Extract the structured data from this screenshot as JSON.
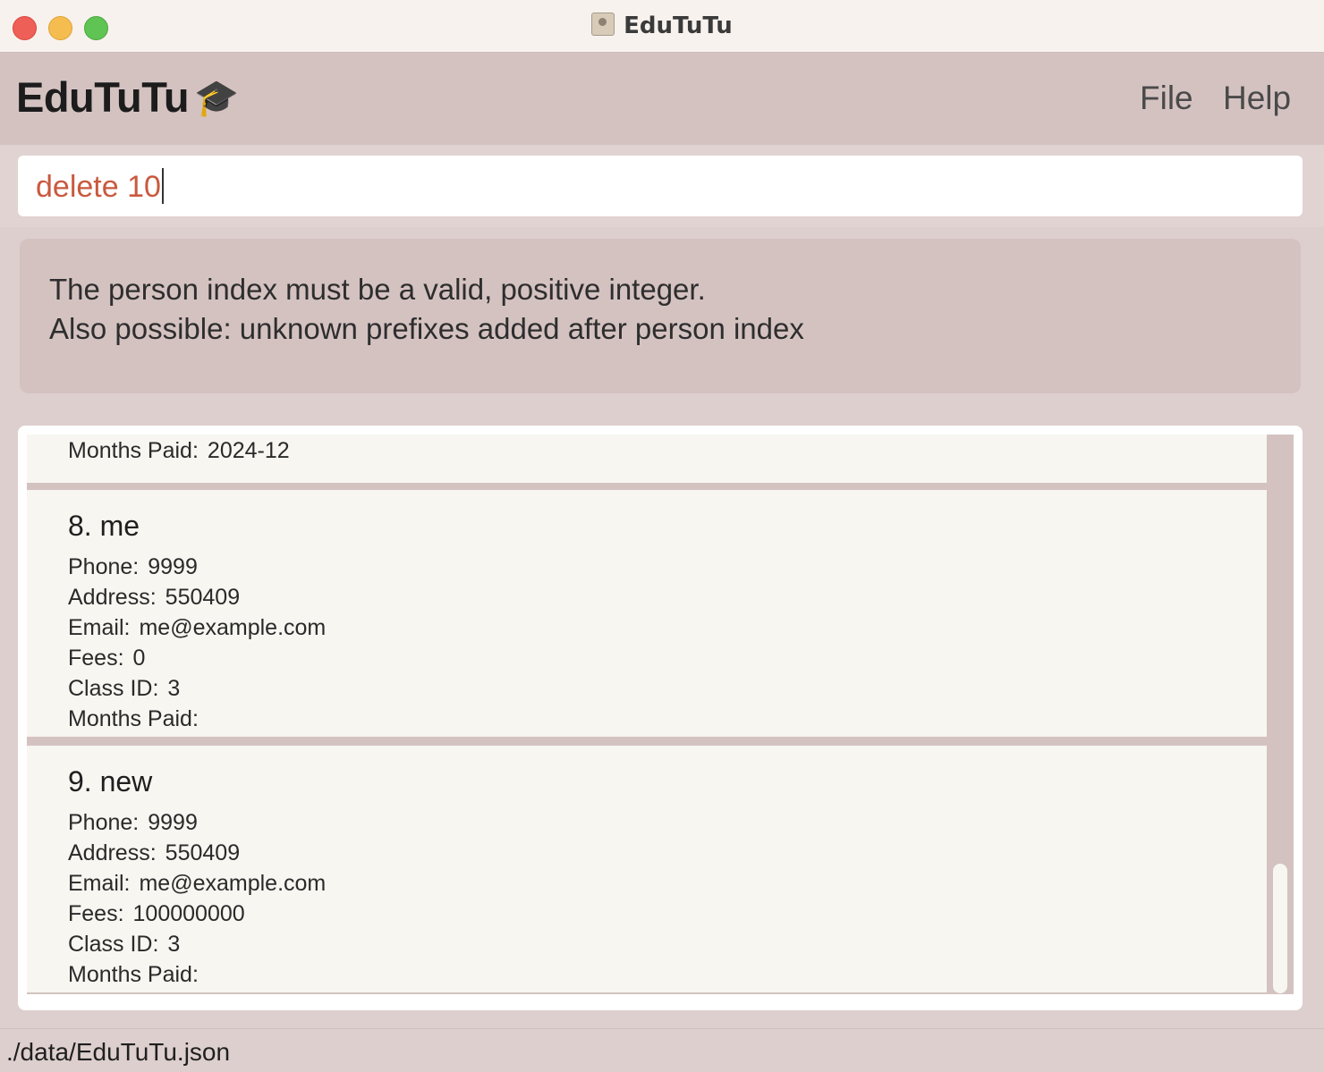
{
  "window": {
    "title": "EduTuTu"
  },
  "header": {
    "brand": "EduTuTu",
    "brand_icon": "🎓",
    "menu": [
      "File",
      "Help"
    ]
  },
  "command": {
    "value": "delete 10"
  },
  "result": {
    "line1": "The person index must be a valid, positive integer.",
    "line2": "Also possible: unknown prefixes added after person index"
  },
  "labels": {
    "phone": "Phone:",
    "address": "Address:",
    "email": "Email:",
    "fees": "Fees:",
    "class_id": "Class ID:",
    "months_paid": "Months Paid:"
  },
  "partial_card": {
    "months_paid": "2024-12"
  },
  "persons": [
    {
      "name": "8. me",
      "phone": "9999",
      "address": "550409",
      "email": "me@example.com",
      "fees": "0",
      "class_id": "3",
      "months_paid": ""
    },
    {
      "name": "9. new",
      "phone": "9999",
      "address": "550409",
      "email": "me@example.com",
      "fees": "100000000",
      "class_id": "3",
      "months_paid": ""
    }
  ],
  "status": {
    "file_path": "./data/EduTuTu.json"
  }
}
